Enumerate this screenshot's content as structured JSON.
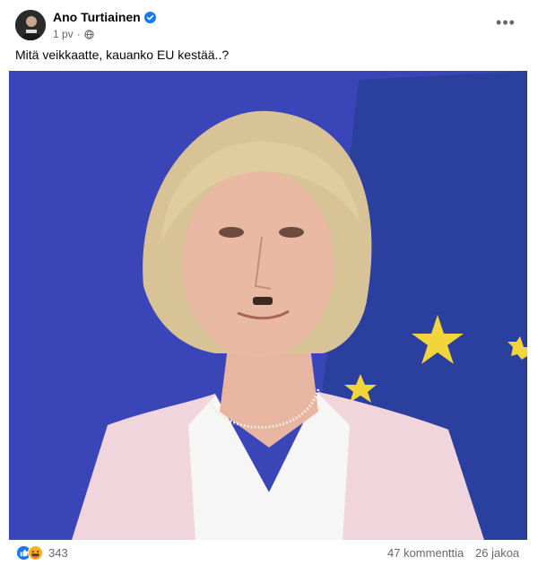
{
  "post": {
    "author": "Ano Turtiainen",
    "time": "1 pv",
    "separator": "·",
    "text": "Mitä veikkaatte, kauanko EU kestää..?",
    "more_label": "•••"
  },
  "photo": {
    "background": "#3a45b8",
    "flag_color": "#2a3f9e",
    "star_color": "#f2d53c"
  },
  "footer": {
    "reaction_icons": [
      "like-icon",
      "haha-icon"
    ],
    "reaction_count": "343",
    "comments": "47 kommenttia",
    "shares": "26 jakoa"
  },
  "colors": {
    "verified": "#1877f2",
    "like": "#1877f2",
    "haha": "#f7b125",
    "muted_text": "#65676b"
  }
}
